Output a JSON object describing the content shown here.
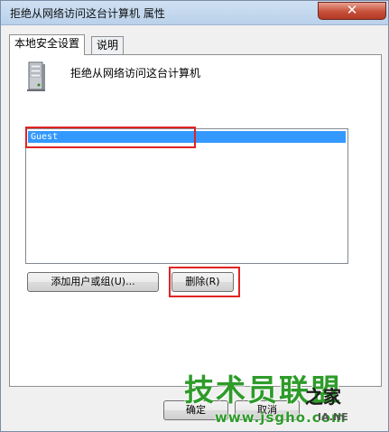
{
  "window": {
    "title": "拒绝从网络访问这台计算机 属性",
    "close_glyph": "✕"
  },
  "tabs": [
    {
      "label": "本地安全设置"
    },
    {
      "label": "说明"
    }
  ],
  "policy": {
    "title": "拒绝从网络访问这台计算机",
    "icon": "server-icon"
  },
  "list": {
    "items": [
      {
        "label": "Guest"
      }
    ]
  },
  "buttons": {
    "add_label": "添加用户或组(U)...",
    "remove_label": "删除(R)",
    "ok_label": "确定",
    "cancel_label": "取消"
  },
  "highlight_color": "#e02424",
  "watermark": {
    "brand": "技术员联盟",
    "family": "之家",
    "url": "www.jsgho.com",
    "tail": "IA.NE"
  }
}
